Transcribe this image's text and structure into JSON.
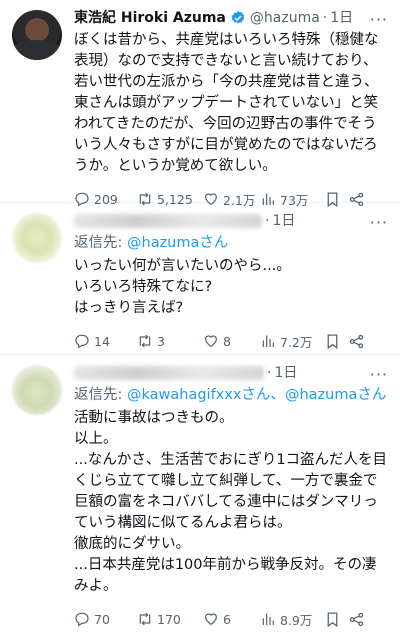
{
  "tweets": [
    {
      "name": "東浩紀 Hiroki Azuma",
      "handle": "@hazuma",
      "dot": "·",
      "time": "1日",
      "reply_prefix": "",
      "reply_targets": [],
      "text": "ぼくは昔から、共産党はいろいろ特殊（穏健な表現）なので支持できないと言い続けており、若い世代の左派から「今の共産党は昔と違う、東さんは頭がアップデートされていない」と笑われてきたのだが、今回の辺野古の事件でそういう人々もさすがに目が覚めたのではないだろうか。というか覚めて欲しい。",
      "replies": "209",
      "retweets": "5,125",
      "likes": "2.1万",
      "views": "73万"
    },
    {
      "name": "",
      "handle": "",
      "dot": "·",
      "time": "1日",
      "reply_prefix": "返信先:",
      "reply_targets": [
        "@hazumaさん"
      ],
      "text": "いったい何が言いたいのやら...。\nいろいろ特殊てなに?\nはっきり言えば?",
      "replies": "14",
      "retweets": "3",
      "likes": "8",
      "views": "7.2万"
    },
    {
      "name": "",
      "handle": "",
      "dot": "·",
      "time": "1日",
      "reply_prefix": "返信先:",
      "reply_targets": [
        "@kawahagifxxxさん、",
        "@hazumaさん"
      ],
      "text": "活動に事故はつきもの。\n以上。\n...なんかさ、生活苦でおにぎり1コ盗んだ人を目くじら立てて囃し立て糾弾して、一方で裏金で巨額の富をネコババしてる連中にはダンマリっていう構図に似てるんよ君らは。\n徹底的にダサい。\n...日本共産党は100年前から戦争反対。その凄みよ。",
      "replies": "70",
      "retweets": "170",
      "likes": "6",
      "views": "8.9万"
    }
  ],
  "icons": {
    "verified": "verified-badge-icon",
    "more": "more-icon",
    "reply": "reply-icon",
    "retweet": "retweet-icon",
    "like": "like-icon",
    "views": "views-icon",
    "bookmark": "bookmark-icon",
    "share": "share-icon"
  },
  "colors": {
    "accent": "#1d9bf0",
    "muted": "#536471",
    "text": "#0f1419"
  },
  "more_label": "···"
}
